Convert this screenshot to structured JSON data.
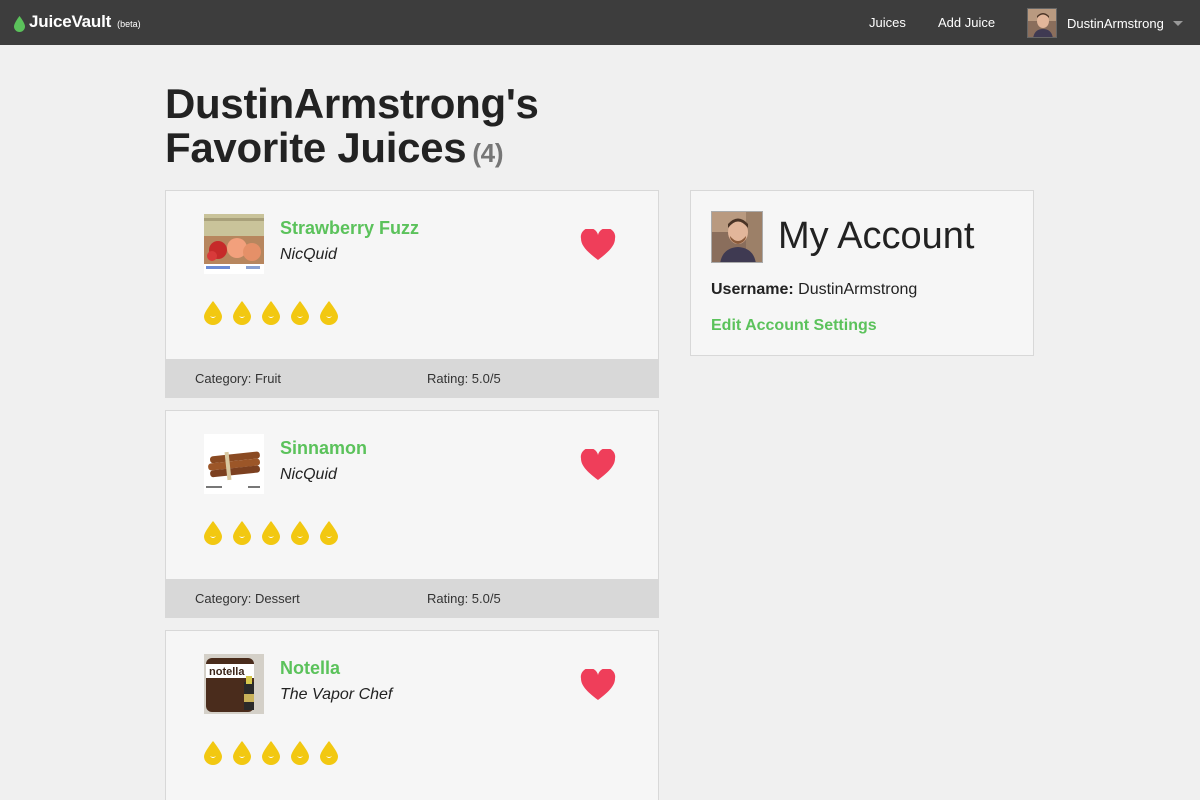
{
  "navbar": {
    "brand": "JuiceVault",
    "beta": "(beta)",
    "links": [
      "Juices",
      "Add Juice"
    ],
    "username": "DustinArmstrong"
  },
  "page": {
    "title_line1": "DustinArmstrong's",
    "title_line2": "Favorite Juices",
    "count": "(4)"
  },
  "juices": [
    {
      "name": "Strawberry Fuzz",
      "brand": "NicQuid",
      "category": "Category: Fruit",
      "rating": "Rating: 5.0/5",
      "drops": 5
    },
    {
      "name": "Sinnamon",
      "brand": "NicQuid",
      "category": "Category: Dessert",
      "rating": "Rating: 5.0/5",
      "drops": 5
    },
    {
      "name": "Notella",
      "brand": "The Vapor Chef",
      "drops": 5
    }
  ],
  "account": {
    "title": "My Account",
    "username_label": "Username:",
    "username": "DustinArmstrong",
    "edit_link": "Edit Account Settings"
  },
  "colors": {
    "accent_green": "#5bc25b",
    "heart_red": "#ef3e5a",
    "drop_yellow": "#f2c811",
    "navbar_bg": "#3d3d3d"
  }
}
